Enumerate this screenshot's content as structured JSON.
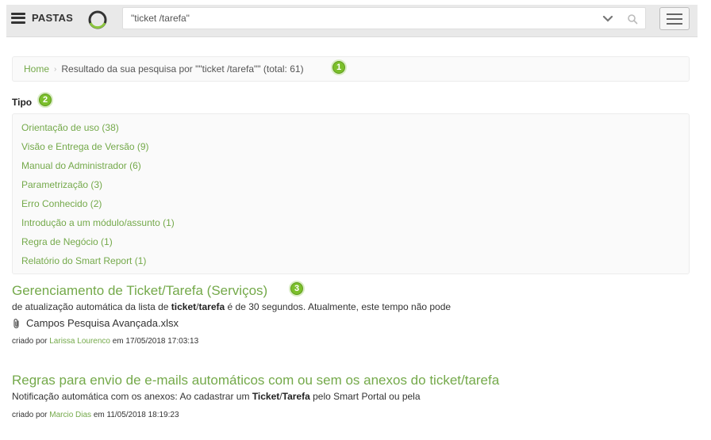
{
  "header": {
    "folders_label": "PASTAS",
    "search_value": "\"ticket /tarefa\""
  },
  "breadcrumb": {
    "home": "Home",
    "separator": "›",
    "current": "Resultado da sua pesquisa por \"\"ticket /tarefa\"\" (total: 61)"
  },
  "markers": [
    "1",
    "2",
    "3"
  ],
  "facets": {
    "title": "Tipo",
    "items": [
      "Orientação de uso (38)",
      "Visão e Entrega de Versão (9)",
      "Manual do Administrador (6)",
      "Parametrização (3)",
      "Erro Conhecido (2)",
      "Introdução a um módulo/assunto (1)",
      "Regra de Negócio (1)",
      "Relatório do Smart Report (1)"
    ]
  },
  "results": [
    {
      "title": "Gerenciamento de Ticket/Tarefa (Serviços)",
      "snippet_before": "de atualização automática da lista de ",
      "snippet_bold1": "ticket",
      "snippet_mid": "/",
      "snippet_bold2": "tarefa",
      "snippet_after": " é de 30 segundos. Atualmente, este tempo não pode",
      "attachment": "Campos Pesquisa Avançada.xlsx",
      "created_by_label": "criado por",
      "author": "Larissa Lourenco",
      "date_text": "em 17/05/2018 17:03:13"
    },
    {
      "title": "Regras para envio de e-mails automáticos com ou sem os anexos do ticket/tarefa",
      "snippet_before": "Notificação automática com os anexos: Ao cadastrar um ",
      "snippet_bold1": "Ticket",
      "snippet_mid": "/",
      "snippet_bold2": "Tarefa",
      "snippet_after": " pelo Smart Portal ou pela",
      "created_by_label": "criado por",
      "author": "Marcio Dias",
      "date_text": "em 11/05/2018 18:19:23"
    }
  ],
  "colors": {
    "link_green": "#74a94a",
    "marker_green": "#7bbf2b",
    "topbar_bg": "#e9e9e9"
  },
  "icons": [
    "hamburger-icon",
    "logo-icon",
    "chevron-down-icon",
    "search-icon",
    "menu-icon",
    "paperclip-icon"
  ]
}
